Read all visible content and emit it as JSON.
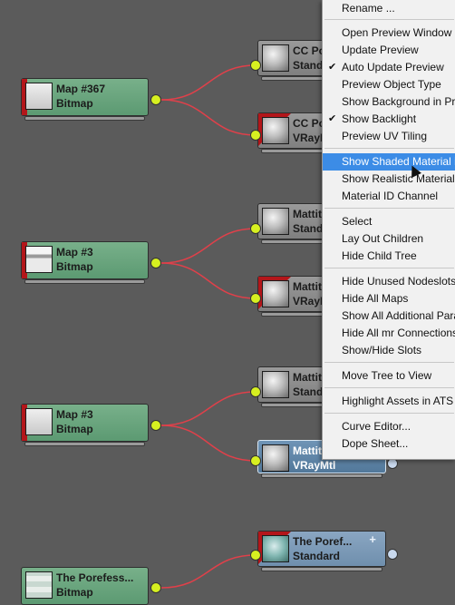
{
  "nodes": {
    "map367": {
      "title": "Map #367",
      "sub": "Bitmap"
    },
    "cc_std": {
      "title": "CC Po",
      "sub": "Standa"
    },
    "cc_vray": {
      "title": "CC Po",
      "sub": "VRayM"
    },
    "map3a": {
      "title": "Map #3",
      "sub": "Bitmap"
    },
    "matt_std1": {
      "title": "Mattit",
      "sub": "Standa"
    },
    "matt_vray1": {
      "title": "Mattit",
      "sub": "VRayM"
    },
    "map3b": {
      "title": "Map #3",
      "sub": "Bitmap"
    },
    "matt_std2": {
      "title": "Mattit",
      "sub": "Standa"
    },
    "matt_vray_sel": {
      "title": "Mattit",
      "sub": "VRayMtl"
    },
    "poref_std": {
      "title": "The  Poref...",
      "sub": "Standard",
      "plus": "+"
    },
    "poref_map": {
      "title": "The Porefess...",
      "sub": "Bitmap"
    }
  },
  "menu": {
    "items": [
      {
        "label": "Rename ...",
        "checked": false
      },
      {
        "label": "Open Preview Window ...",
        "checked": false
      },
      {
        "label": "Update Preview",
        "checked": false
      },
      {
        "label": "Auto Update Preview",
        "checked": true
      },
      {
        "label": "Preview Object Type",
        "checked": false
      },
      {
        "label": "Show Background in Preview",
        "checked": false
      },
      {
        "label": "Show Backlight",
        "checked": true
      },
      {
        "label": "Preview UV Tiling",
        "checked": false
      },
      {
        "label": "Show Shaded Material in Viewport",
        "checked": false,
        "highlighted": true
      },
      {
        "label": "Show Realistic Material in Viewport",
        "checked": false
      },
      {
        "label": "Material ID Channel",
        "checked": false
      },
      {
        "label": "Select",
        "checked": false
      },
      {
        "label": "Lay Out Children",
        "checked": false
      },
      {
        "label": "Hide Child Tree",
        "checked": false
      },
      {
        "label": "Hide Unused Nodeslots",
        "checked": false
      },
      {
        "label": "Hide All Maps",
        "checked": false
      },
      {
        "label": "Show All Additional Params",
        "checked": false
      },
      {
        "label": "Hide All mr Connections",
        "checked": false
      },
      {
        "label": "Show/Hide Slots",
        "checked": false
      },
      {
        "label": "Move Tree to View",
        "checked": false
      },
      {
        "label": "Highlight Assets in ATS Dialog",
        "checked": false
      },
      {
        "label": "Curve Editor...",
        "checked": false
      },
      {
        "label": "Dope Sheet...",
        "checked": false
      }
    ],
    "check_glyph": "✔"
  },
  "colors": {
    "canvas": "#5b5b5b",
    "map_node": "#6aa67e",
    "material_node": "#8c8c8c",
    "selected_node": "#5f86aa",
    "wire": "#e0404a",
    "output_socket": "#d7f020",
    "highlight": "#3c8ce6",
    "red_flag": "#b3161a"
  }
}
